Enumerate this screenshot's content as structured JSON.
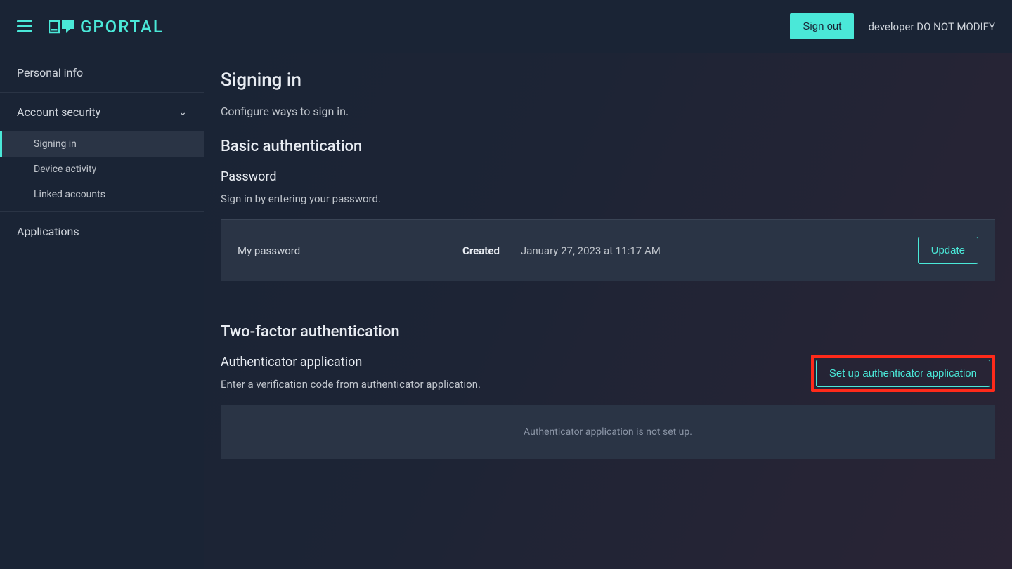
{
  "header": {
    "logo_text": "GPORTAL",
    "signout_label": "Sign out",
    "user_label": "developer DO NOT MODIFY"
  },
  "sidebar": {
    "items": [
      {
        "label": "Personal info"
      },
      {
        "label": "Account security",
        "expanded": true,
        "children": [
          {
            "label": "Signing in",
            "active": true
          },
          {
            "label": "Device activity"
          },
          {
            "label": "Linked accounts"
          }
        ]
      },
      {
        "label": "Applications"
      }
    ]
  },
  "main": {
    "title": "Signing in",
    "description": "Configure ways to sign in.",
    "basic_auth": {
      "title": "Basic authentication",
      "password": {
        "title": "Password",
        "description": "Sign in by entering your password.",
        "row": {
          "label": "My password",
          "created_label": "Created",
          "created_value": "January 27, 2023 at 11:17 AM",
          "action": "Update"
        }
      }
    },
    "twofa": {
      "title": "Two-factor authentication",
      "authenticator": {
        "title": "Authenticator application",
        "description": "Enter a verification code from authenticator application.",
        "action": "Set up authenticator application",
        "empty_state": "Authenticator application is not set up."
      }
    }
  }
}
